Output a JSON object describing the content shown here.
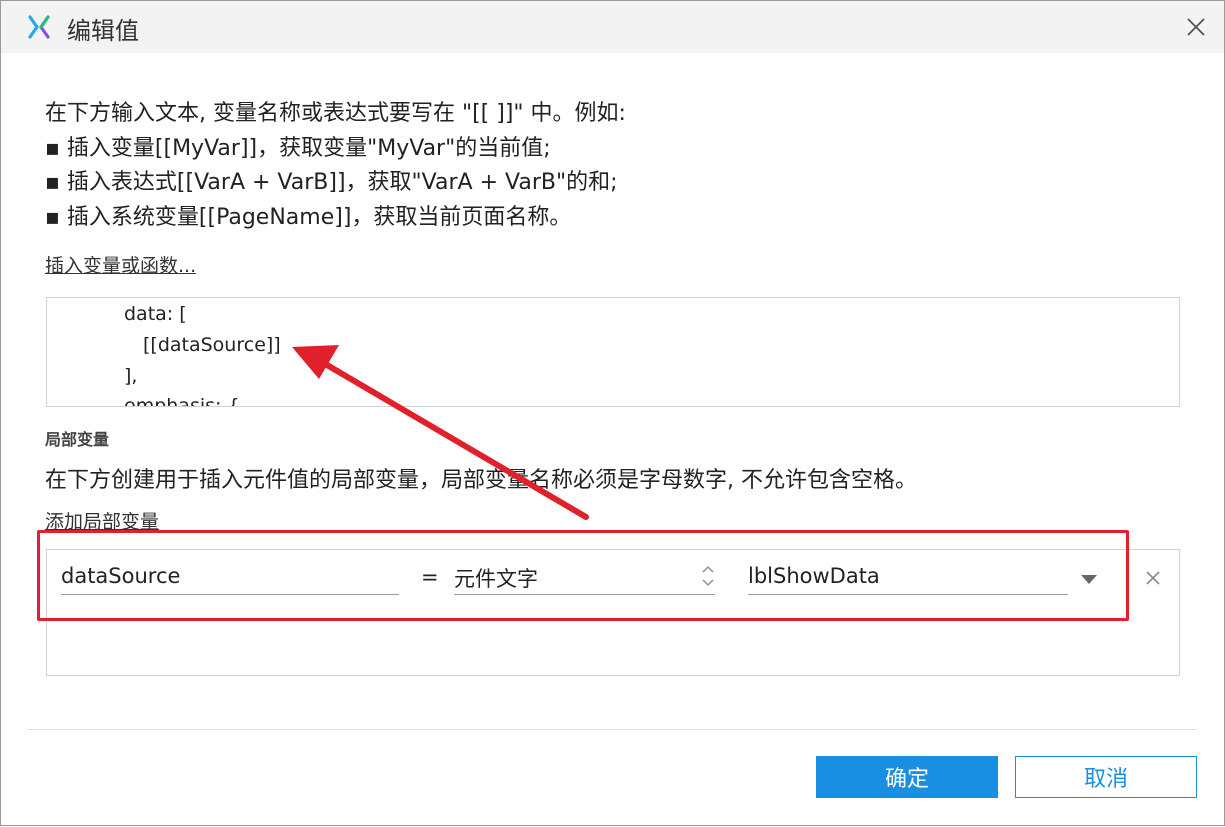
{
  "dialog": {
    "title": "编辑值"
  },
  "intro": {
    "line1": "在下方输入文本, 变量名称或表达式要写在 \"[[ ]]\" 中。例如:",
    "line2": "▪ 插入变量[[MyVar]]，获取变量\"MyVar\"的当前值;",
    "line3": "▪ 插入表达式[[VarA + VarB]]，获取\"VarA + VarB\"的和;",
    "line4": "▪ 插入系统变量[[PageName]]，获取当前页面名称。"
  },
  "insert_link": "插入变量或函数...",
  "editor": {
    "line1": "data: [",
    "line2": "[[dataSource]]",
    "line3": "],",
    "line4": "emphasis: {"
  },
  "local_vars": {
    "section_title": "局部变量",
    "description": "在下方创建用于插入元件值的局部变量，局部变量名称必须是字母数字, 不允许包含空格。",
    "add_link": "添加局部变量",
    "rows": [
      {
        "name": "dataSource",
        "equals": "=",
        "type": "元件文字",
        "target": "lblShowData"
      }
    ]
  },
  "buttons": {
    "ok": "确定",
    "cancel": "取消"
  },
  "colors": {
    "accent": "#1a8ee1",
    "annotation": "#e0202a"
  }
}
